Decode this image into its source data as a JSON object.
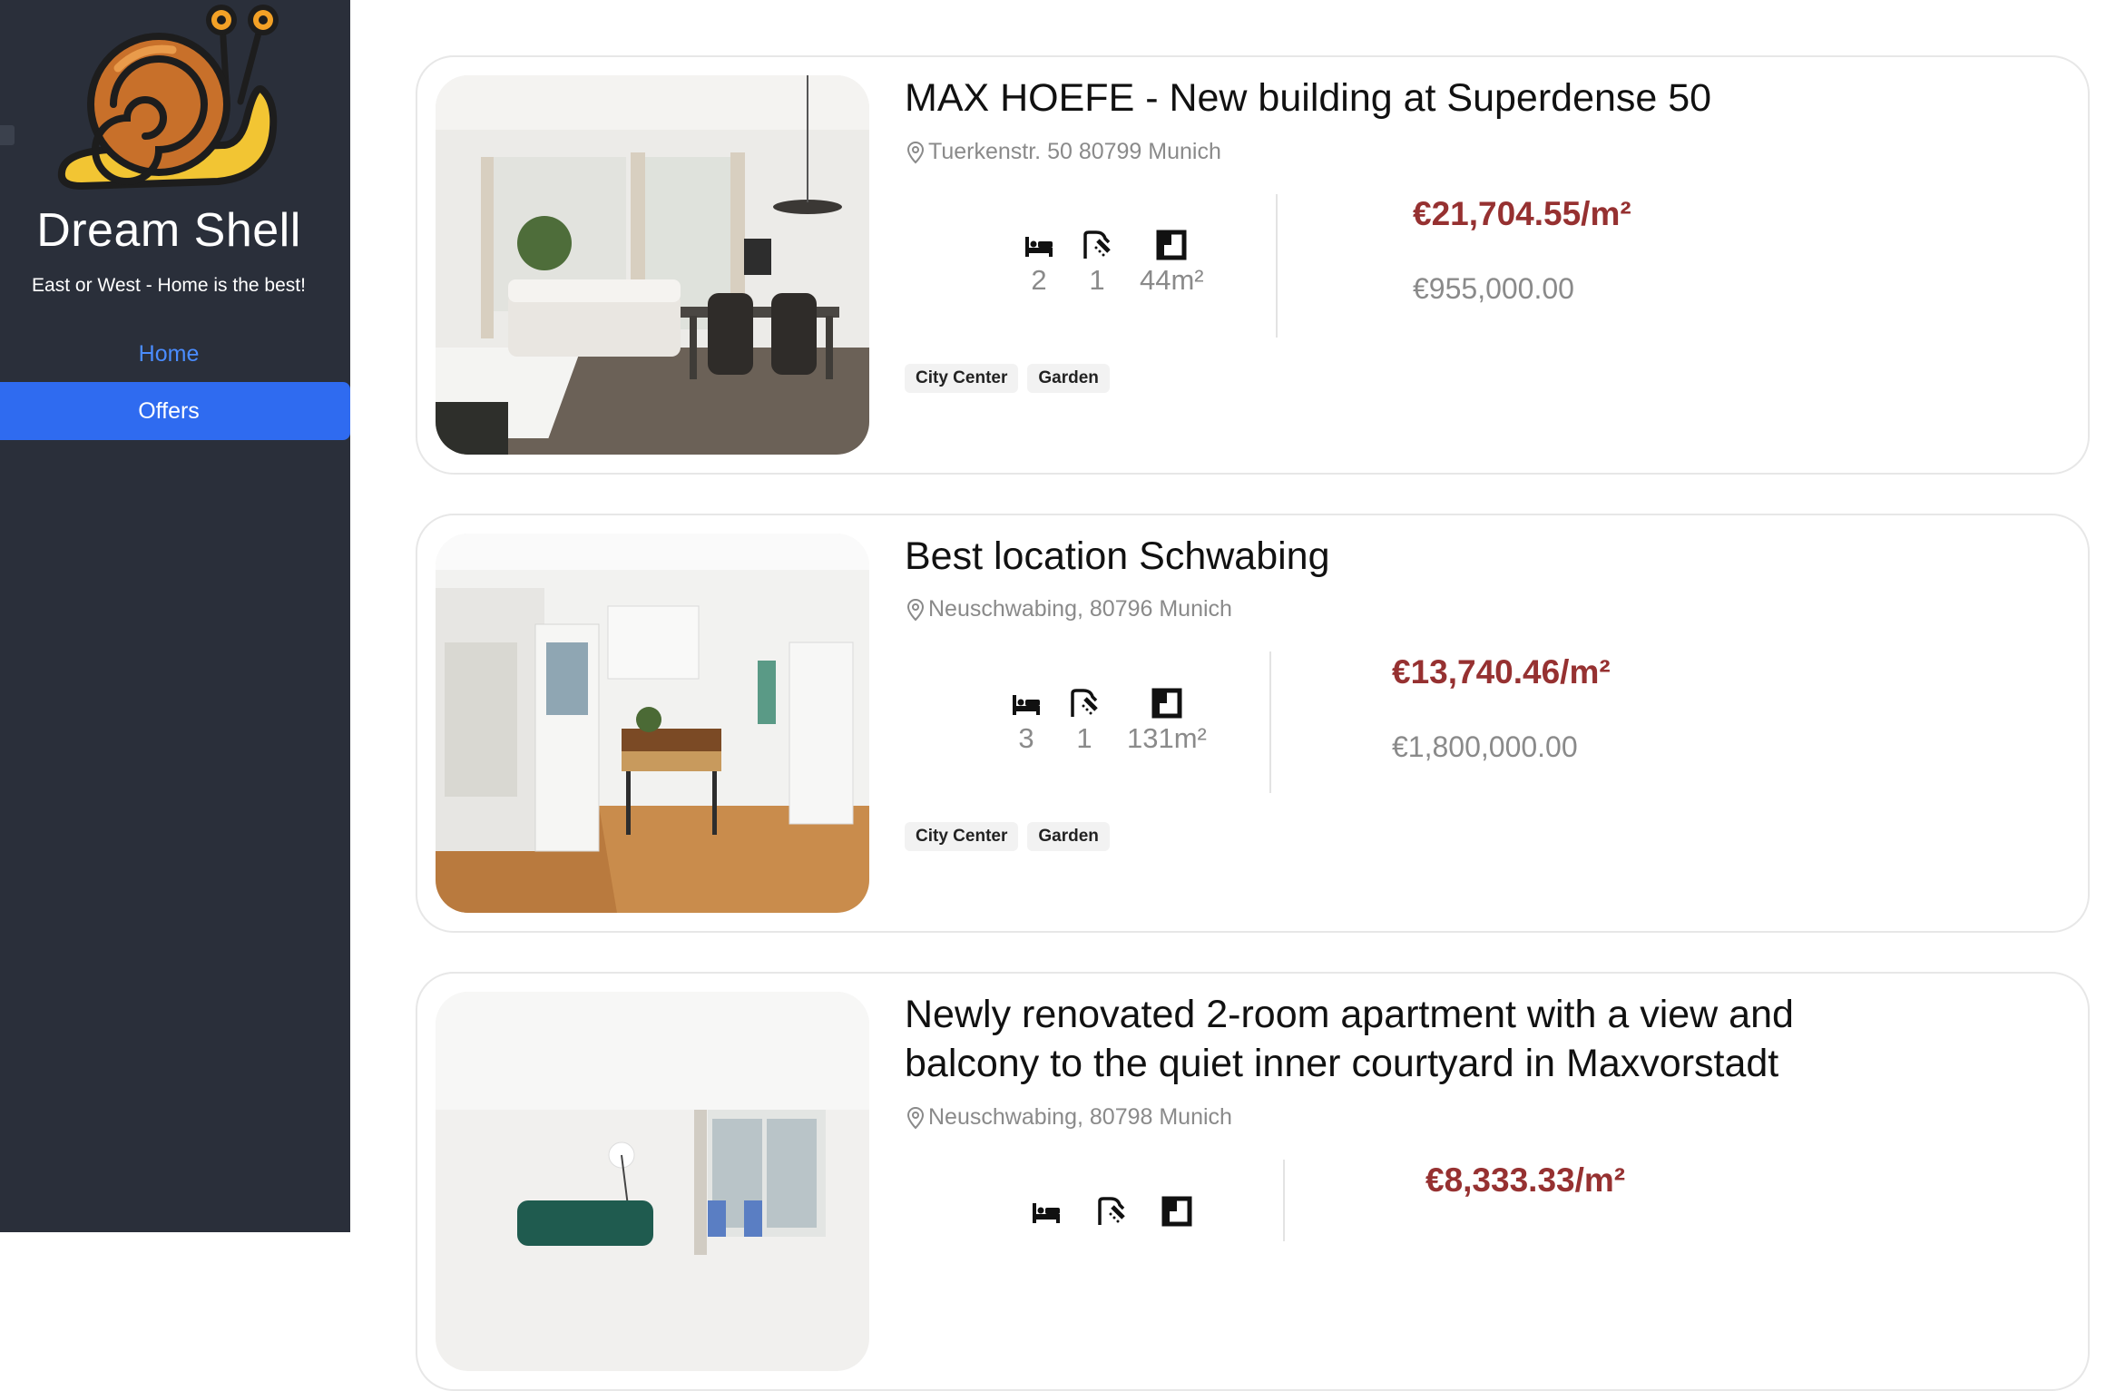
{
  "sidebar": {
    "brand": "Dream Shell",
    "tagline": "East or West - Home is the best!",
    "nav": [
      {
        "label": "Home",
        "active": false
      },
      {
        "label": "Offers",
        "active": true
      }
    ],
    "accent_color": "#2f6bf0",
    "background_color": "#2a2f3a"
  },
  "listings": [
    {
      "title": "MAX HOEFE - New building at Superdense 50",
      "address": "Tuerkenstr. 50 80799 Munich",
      "bedrooms": "2",
      "bathrooms": "1",
      "area": "44m²",
      "price_per_sqm": "€21,704.55/m²",
      "price": "€955,000.00",
      "tags": [
        "City Center",
        "Garden"
      ]
    },
    {
      "title": "Best location Schwabing",
      "address": "Neuschwabing, 80796 Munich",
      "bedrooms": "3",
      "bathrooms": "1",
      "area": "131m²",
      "price_per_sqm": "€13,740.46/m²",
      "price": "€1,800,000.00",
      "tags": [
        "City Center",
        "Garden"
      ]
    },
    {
      "title": "Newly renovated 2-room apartment with a view and balcony to the quiet inner courtyard in Maxvorstadt",
      "address": "Neuschwabing, 80798 Munich",
      "price_per_sqm": "€8,333.33/m²"
    }
  ],
  "icons": {
    "bed": "bed-icon",
    "shower": "shower-icon",
    "area": "floorplan-icon",
    "location": "location-pin-icon"
  },
  "colors": {
    "price_per_sqm": "#963131",
    "muted_text": "#8a8a8a"
  }
}
